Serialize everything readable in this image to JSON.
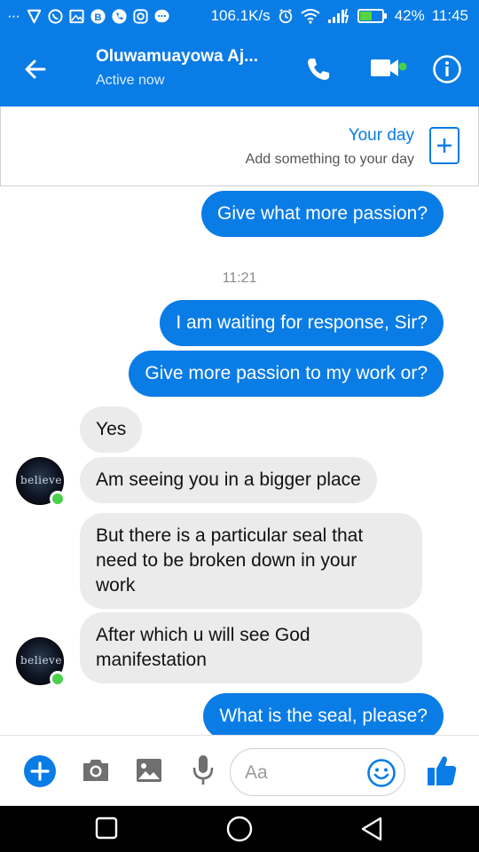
{
  "status_bar": {
    "more_dots": "···",
    "network_speed": "106.1K/s",
    "battery_percent": "42%",
    "time": "11:45",
    "icons": [
      "vpn-icon",
      "whatsapp-icon",
      "gallery-icon",
      "b-icon",
      "call-icon",
      "instagram-icon",
      "messenger-icon",
      "alarm-icon",
      "wifi-icon",
      "signal-icon",
      "battery-icon"
    ]
  },
  "header": {
    "contact_name": "Oluwamuayowa Aj...",
    "presence": "Active now"
  },
  "your_day": {
    "title": "Your day",
    "subtitle": "Add something to your day"
  },
  "messages": [
    {
      "from": "me",
      "text": "Give what more passion?"
    },
    {
      "from": "them",
      "text": "Yes"
    },
    {
      "from": "them",
      "text": "Am seeing you in a bigger place"
    },
    {
      "from": "them",
      "line1": "But there is a particular seal that",
      "line2": "need to be broken down in your",
      "line3": "work"
    },
    {
      "from": "them",
      "line1": "After which u will see God",
      "line2": "manifestation"
    },
    {
      "from": "me",
      "text": "What is the seal, please?"
    }
  ],
  "timestamp": "11:21",
  "sent_after_time": [
    {
      "from": "me",
      "text": "I am waiting for response, Sir?"
    },
    {
      "from": "me",
      "text": "Give more passion to my work or?"
    }
  ],
  "avatar": {
    "logo_text": "believe"
  },
  "composer": {
    "placeholder": "Aa"
  },
  "colors": {
    "brand": "#0a7ce6",
    "incoming_bubble": "#ebebeb",
    "online": "#4ad04a"
  }
}
